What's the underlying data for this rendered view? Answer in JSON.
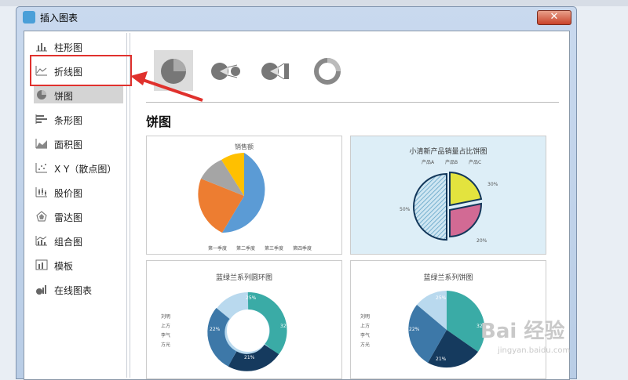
{
  "window": {
    "title": "插入图表",
    "close_label": "✕"
  },
  "sidebar": {
    "items": [
      {
        "label": "柱形图",
        "icon": "column-chart-icon"
      },
      {
        "label": "折线图",
        "icon": "line-chart-icon"
      },
      {
        "label": "饼图",
        "icon": "pie-chart-icon"
      },
      {
        "label": "条形图",
        "icon": "bar-chart-icon"
      },
      {
        "label": "面积图",
        "icon": "area-chart-icon"
      },
      {
        "label": "X Y（散点图）",
        "icon": "scatter-chart-icon"
      },
      {
        "label": "股价图",
        "icon": "stock-chart-icon"
      },
      {
        "label": "雷达图",
        "icon": "radar-chart-icon"
      },
      {
        "label": "组合图",
        "icon": "combo-chart-icon"
      },
      {
        "label": "模板",
        "icon": "template-icon"
      },
      {
        "label": "在线图表",
        "icon": "online-chart-icon"
      }
    ],
    "selected": "饼图"
  },
  "content": {
    "heading": "饼图",
    "subtypes": [
      "pie",
      "pie-of-pie",
      "bar-of-pie",
      "doughnut"
    ],
    "cards": [
      {
        "title": "销售额",
        "legend": [
          "第一季度",
          "第二季度",
          "第三季度",
          "第四季度"
        ]
      },
      {
        "title": "小清新产品销量占比饼图",
        "legend": [
          "产品A",
          "产品B",
          "产品C"
        ],
        "labels": [
          "30%",
          "20%",
          "50%"
        ]
      },
      {
        "title": "蓝绿兰系列圆环图",
        "legend": [
          "刘明",
          "上方",
          "李气",
          "方光"
        ],
        "labels": [
          "25%",
          "32%",
          "21%",
          "22%"
        ]
      },
      {
        "title": "蓝绿兰系列饼图",
        "legend": [
          "刘明",
          "上方",
          "李气",
          "方光"
        ],
        "labels": [
          "25%",
          "32%",
          "21%",
          "22%"
        ]
      }
    ]
  },
  "annotation": {
    "color": "#e0312d"
  },
  "watermark": {
    "text": "Bai 经验",
    "sub": "jingyan.baidu.com"
  }
}
